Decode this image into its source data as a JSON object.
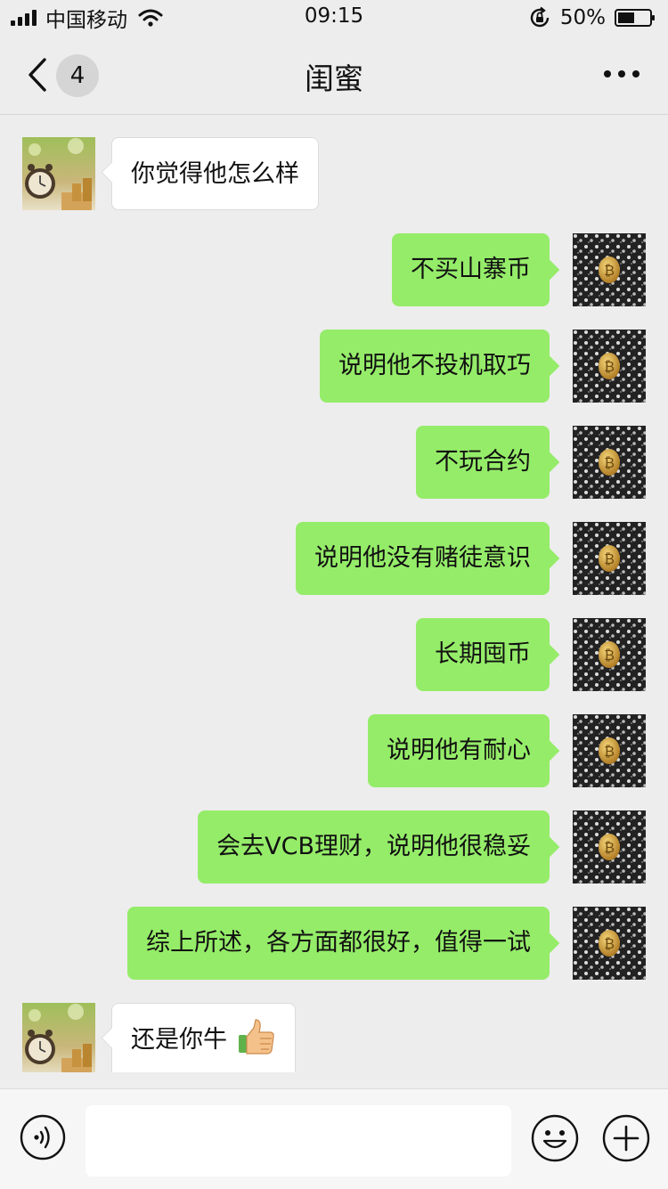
{
  "status_bar": {
    "carrier": "中国移动",
    "time": "09:15",
    "battery": "50%"
  },
  "nav": {
    "unread_count": "4",
    "title": "闺蜜"
  },
  "messages": [
    {
      "side": "in",
      "text": "你觉得他怎么样"
    },
    {
      "side": "out",
      "text": "不买山寨币"
    },
    {
      "side": "out",
      "text": "说明他不投机取巧"
    },
    {
      "side": "out",
      "text": "不玩合约"
    },
    {
      "side": "out",
      "text": "说明他没有赌徒意识"
    },
    {
      "side": "out",
      "text": "长期囤币"
    },
    {
      "side": "out",
      "text": "说明他有耐心"
    },
    {
      "side": "out",
      "text": "会去VCB理财，说明他很稳妥"
    },
    {
      "side": "out",
      "text": "综上所述，各方面都很好，值得一试"
    },
    {
      "side": "in",
      "text": "还是你牛",
      "emoji": "thumbs-up-icon"
    }
  ],
  "input": {
    "value": "",
    "placeholder": ""
  },
  "colors": {
    "background": "#ededed",
    "outgoing_bubble": "#95ec69",
    "incoming_bubble": "#ffffff"
  },
  "icons": {
    "back": "chevron-left-icon",
    "more": "more-dots-icon",
    "voice": "voice-icon",
    "emoji": "emoji-smile-icon",
    "add": "plus-circle-icon"
  }
}
